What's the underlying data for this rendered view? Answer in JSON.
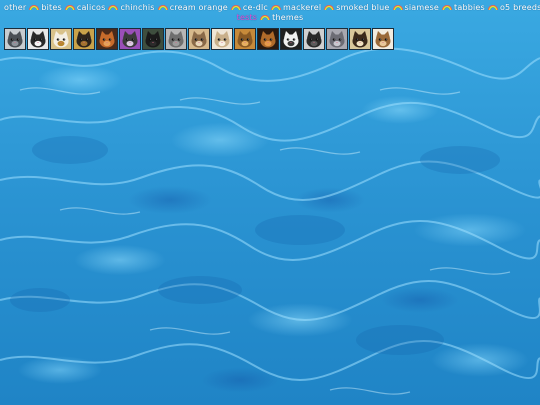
{
  "nav": {
    "row1": [
      {
        "label": "other",
        "current": false
      },
      {
        "label": "bites",
        "current": false
      },
      {
        "label": "calicos",
        "current": false
      },
      {
        "label": "chinchis",
        "current": false
      },
      {
        "label": "cream orange",
        "current": false
      },
      {
        "label": "ce-dlc",
        "current": false
      },
      {
        "label": "mackerel",
        "current": false
      },
      {
        "label": "smoked blue",
        "current": false
      },
      {
        "label": "siamese",
        "current": false
      },
      {
        "label": "tabbies",
        "current": false
      },
      {
        "label": "o5 breeds",
        "current": false
      }
    ],
    "row2": [
      {
        "label": "tests",
        "current": true
      },
      {
        "label": "themes",
        "current": false
      }
    ]
  },
  "cats": [
    {
      "name": "cat-1",
      "bg": "#c7ccd0",
      "fur": "#4a4f55",
      "face": "#8e949b"
    },
    {
      "name": "cat-2",
      "bg": "#e8e8e8",
      "fur": "#2a2a2a",
      "face": "#f5f5f5"
    },
    {
      "name": "cat-3",
      "bg": "#d9c28a",
      "fur": "#f4efe3",
      "face": "#b8862e"
    },
    {
      "name": "cat-4",
      "bg": "#c9a24a",
      "fur": "#2d241c",
      "face": "#a3732f"
    },
    {
      "name": "cat-5",
      "bg": "#4a2a1a",
      "fur": "#c76b2b",
      "face": "#e8a15a"
    },
    {
      "name": "cat-6",
      "bg": "#9a4fb8",
      "fur": "#3a3a3a",
      "face": "#d8c9e0"
    },
    {
      "name": "cat-7",
      "bg": "#3e4e3e",
      "fur": "#1a1a1a",
      "face": "#2b2b2b"
    },
    {
      "name": "cat-8",
      "bg": "#b6b6b6",
      "fur": "#6f6f6f",
      "face": "#9c9c9c"
    },
    {
      "name": "cat-9",
      "bg": "#d6b98c",
      "fur": "#8a6a48",
      "face": "#e8d6b8"
    },
    {
      "name": "cat-10",
      "bg": "#efe6d6",
      "fur": "#c9b08a",
      "face": "#f5efe3"
    },
    {
      "name": "cat-11",
      "bg": "#c78a3a",
      "fur": "#8a5a24",
      "face": "#e8b060"
    },
    {
      "name": "cat-12",
      "bg": "#2a1a10",
      "fur": "#b06b2a",
      "face": "#e59a4a"
    },
    {
      "name": "cat-13",
      "bg": "#1f1f1f",
      "fur": "#f0f0f0",
      "face": "#3a3a3a"
    },
    {
      "name": "cat-14",
      "bg": "#d0d0d0",
      "fur": "#2a2a2a",
      "face": "#5a5a5a"
    },
    {
      "name": "cat-15",
      "bg": "#a8a8b0",
      "fur": "#6c6c74",
      "face": "#c8c8cf"
    },
    {
      "name": "cat-16",
      "bg": "#d8c89a",
      "fur": "#3a2a1a",
      "face": "#efe2c0"
    },
    {
      "name": "cat-17",
      "bg": "#f2ece0",
      "fur": "#9a6a3a",
      "face": "#e8c79a"
    }
  ]
}
